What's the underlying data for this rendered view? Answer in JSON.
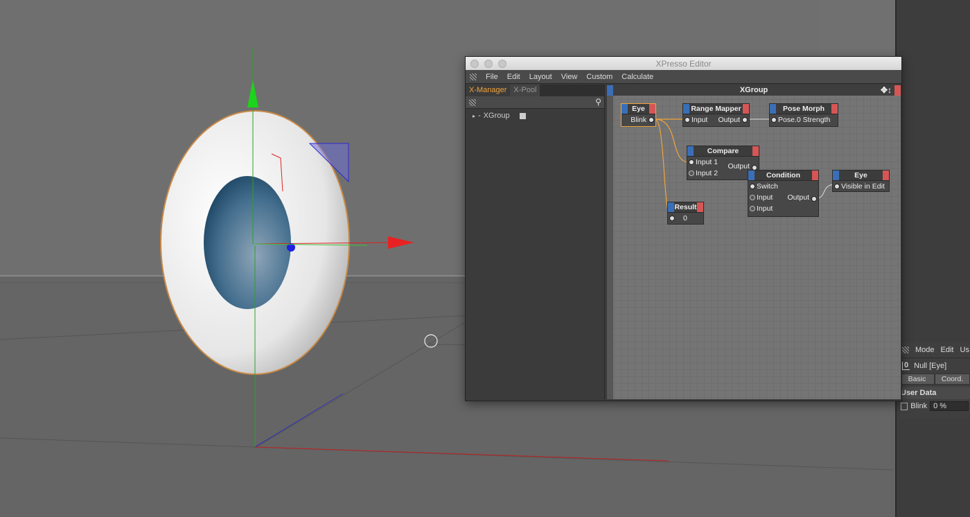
{
  "window": {
    "title": "XPresso Editor"
  },
  "menu": [
    "File",
    "Edit",
    "Layout",
    "View",
    "Custom",
    "Calculate"
  ],
  "left_tabs": [
    "X-Manager",
    "X-Pool"
  ],
  "tree_item": "XGroup",
  "graph_title": "XGroup",
  "nodes": {
    "eye1": {
      "title": "Eye",
      "port": "Blink"
    },
    "range": {
      "title": "Range Mapper",
      "in": "Input",
      "out": "Output"
    },
    "pose": {
      "title": "Pose Morph",
      "in": "Pose.0 Strength"
    },
    "compare": {
      "title": "Compare",
      "in1": "Input 1",
      "in2": "Input 2",
      "out": "Output"
    },
    "condition": {
      "title": "Condition",
      "sw": "Switch",
      "in1": "Input",
      "in2": "Input",
      "out": "Output"
    },
    "eye2": {
      "title": "Eye",
      "in": "Visible in Edit"
    },
    "result": {
      "title": "Result",
      "value": "0"
    }
  },
  "attributes": {
    "menu": [
      "Mode",
      "Edit",
      "Us"
    ],
    "object": "Null [Eye]",
    "tabs": [
      "Basic",
      "Coord."
    ],
    "section": "User Data",
    "field_label": "Blink",
    "field_value": "0 %"
  }
}
